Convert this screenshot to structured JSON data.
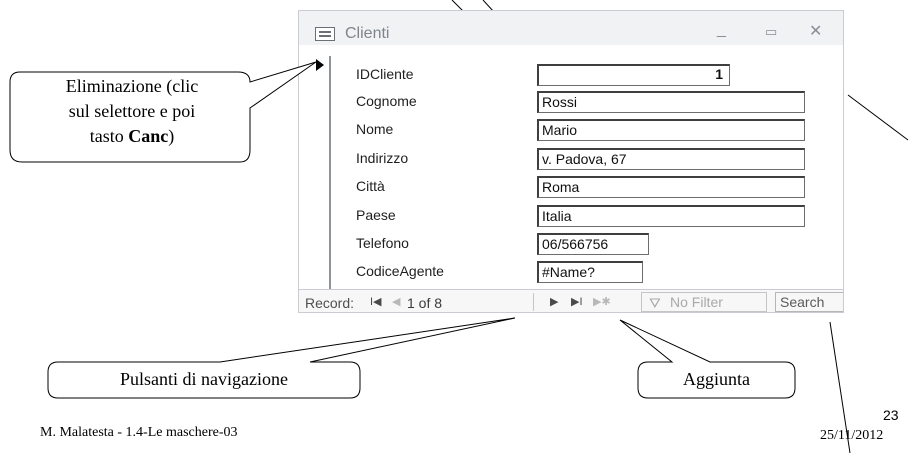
{
  "window": {
    "title": "Clienti",
    "minimize_glyph": "_",
    "maximize_glyph": "▭",
    "close_glyph": "✕",
    "icon": "form-icon"
  },
  "fields": [
    {
      "label": "IDCliente",
      "value": "1"
    },
    {
      "label": "Cognome",
      "value": "Rossi"
    },
    {
      "label": "Nome",
      "value": "Mario"
    },
    {
      "label": "Indirizzo",
      "value": "v. Padova, 67"
    },
    {
      "label": "Città",
      "value": "Roma"
    },
    {
      "label": "Paese",
      "value": "Italia"
    },
    {
      "label": "Telefono",
      "value": "06/566756"
    },
    {
      "label": "CodiceAgente",
      "value": "#Name?"
    }
  ],
  "navbar": {
    "record_label": "Record:",
    "first_glyph": "I◀",
    "prev_glyph": "◀",
    "position": "1 of 8",
    "next_glyph": "▶",
    "last_glyph": "▶I",
    "new_glyph": "▶✱",
    "filter_label": "No Filter",
    "search_label": "Search"
  },
  "callouts": {
    "delete": {
      "line1": "Eliminazione (clic",
      "line2": "sul selettore e poi",
      "line3_prefix": "tasto ",
      "line3_bold": "Canc",
      "line3_suffix": ")"
    },
    "nav": "Pulsanti di navigazione",
    "add": "Aggiunta"
  },
  "footer": {
    "author": "M. Malatesta - 1.4-Le maschere-03",
    "page": "23",
    "date": "25/11/2012"
  },
  "colors": {
    "window_border": "#c9ccd2",
    "titlebar": "#f1f2f4",
    "text_muted": "#7e848b"
  }
}
